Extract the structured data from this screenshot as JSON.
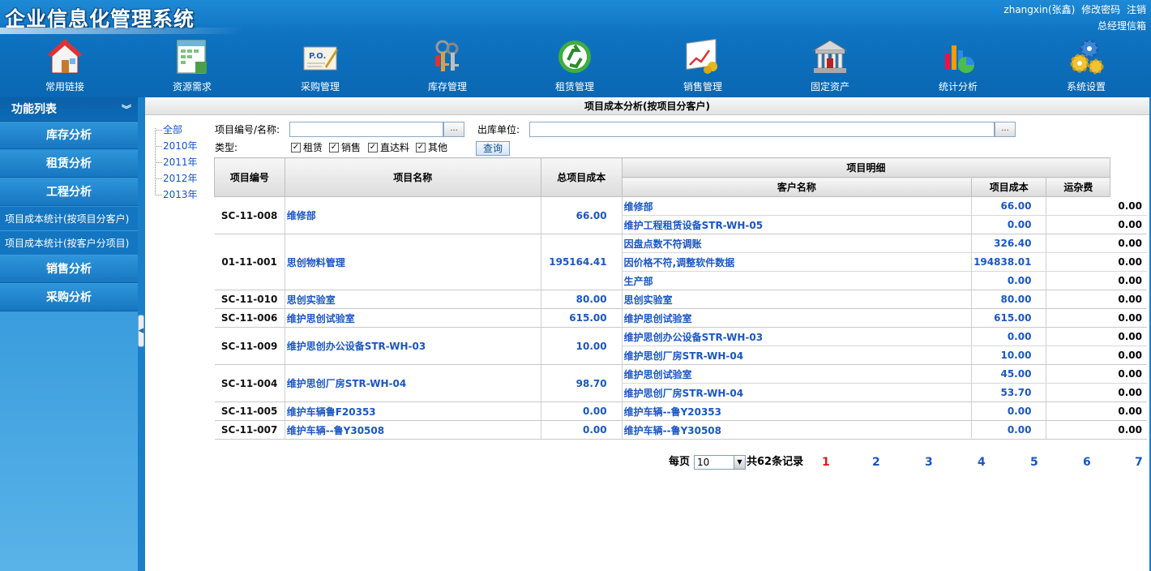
{
  "app": {
    "title": "企业信息化管理系统"
  },
  "user": {
    "name": "zhangxin(张鑫)",
    "change_password": "修改密码",
    "logout": "注销",
    "mailbox": "总经理信箱"
  },
  "nav": [
    {
      "label": "常用链接",
      "icon": "home-icon"
    },
    {
      "label": "资源需求",
      "icon": "calendar-icon"
    },
    {
      "label": "采购管理",
      "icon": "purchase-order-icon"
    },
    {
      "label": "库存管理",
      "icon": "keys-icon"
    },
    {
      "label": "租赁管理",
      "icon": "recycle-icon"
    },
    {
      "label": "销售管理",
      "icon": "sales-chart-icon"
    },
    {
      "label": "固定资产",
      "icon": "bank-icon"
    },
    {
      "label": "统计分析",
      "icon": "statistics-icon"
    },
    {
      "label": "系统设置",
      "icon": "gears-icon"
    }
  ],
  "sidebar": {
    "title": "功能列表",
    "items": [
      {
        "label": "库存分析"
      },
      {
        "label": "租赁分析"
      },
      {
        "label": "工程分析"
      }
    ],
    "subitems": [
      {
        "label": "项目成本统计(按项目分客户)"
      },
      {
        "label": "项目成本统计(按客户分项目)"
      }
    ],
    "items2": [
      {
        "label": "销售分析"
      },
      {
        "label": "采购分析"
      }
    ]
  },
  "page": {
    "title": "项目成本分析(按项目分客户)"
  },
  "tree": [
    "全部",
    "2010年",
    "2011年",
    "2012年",
    "2013年"
  ],
  "filters": {
    "project_label": "项目编号/名称:",
    "project_value": "",
    "browse": "...",
    "outbound_label": "出库单位:",
    "outbound_value": "",
    "type_label": "类型:",
    "types": [
      "租赁",
      "销售",
      "直达料",
      "其他"
    ],
    "query": "查询"
  },
  "table": {
    "headers": {
      "code": "项目编号",
      "name": "项目名称",
      "total": "总项目成本",
      "detail": "项目明细",
      "customer": "客户名称",
      "cost": "项目成本",
      "fee": "运杂费"
    },
    "rows": [
      {
        "code": "SC-11-008",
        "name": "维修部",
        "total": "66.00",
        "details": [
          {
            "customer": "维修部",
            "cost": "66.00",
            "fee": "0.00"
          },
          {
            "customer": "维护工程租赁设备STR-WH-05",
            "cost": "0.00",
            "fee": "0.00"
          }
        ]
      },
      {
        "code": "01-11-001",
        "name": "思创物料管理",
        "total": "195164.41",
        "details": [
          {
            "customer": "因盘点数不符调账",
            "cost": "326.40",
            "fee": "0.00"
          },
          {
            "customer": "因价格不符,调整软件数据",
            "cost": "194838.01",
            "fee": "0.00"
          },
          {
            "customer": "生产部",
            "cost": "0.00",
            "fee": "0.00"
          }
        ]
      },
      {
        "code": "SC-11-010",
        "name": "思创实验室",
        "total": "80.00",
        "details": [
          {
            "customer": "思创实验室",
            "cost": "80.00",
            "fee": "0.00"
          }
        ]
      },
      {
        "code": "SC-11-006",
        "name": "维护思创试验室",
        "total": "615.00",
        "details": [
          {
            "customer": "维护思创试验室",
            "cost": "615.00",
            "fee": "0.00"
          }
        ]
      },
      {
        "code": "SC-11-009",
        "name": "维护思创办公设备STR-WH-03",
        "total": "10.00",
        "details": [
          {
            "customer": "维护思创办公设备STR-WH-03",
            "cost": "0.00",
            "fee": "0.00"
          },
          {
            "customer": "维护思创厂房STR-WH-04",
            "cost": "10.00",
            "fee": "0.00"
          }
        ]
      },
      {
        "code": "SC-11-004",
        "name": "维护思创厂房STR-WH-04",
        "total": "98.70",
        "details": [
          {
            "customer": "维护思创试验室",
            "cost": "45.00",
            "fee": "0.00"
          },
          {
            "customer": "维护思创厂房STR-WH-04",
            "cost": "53.70",
            "fee": "0.00"
          }
        ]
      },
      {
        "code": "SC-11-005",
        "name": "维护车辆鲁F20353",
        "total": "0.00",
        "details": [
          {
            "customer": "维护车辆--鲁Y20353",
            "cost": "0.00",
            "fee": "0.00"
          }
        ]
      },
      {
        "code": "SC-11-007",
        "name": "维护车辆--鲁Y30508",
        "total": "0.00",
        "details": [
          {
            "customer": "维护车辆--鲁Y30508",
            "cost": "0.00",
            "fee": "0.00"
          }
        ]
      }
    ]
  },
  "pager": {
    "per_page_label": "每页",
    "per_page": "10",
    "total_prefix": "共",
    "total_count": "62",
    "total_suffix": "条记录",
    "pages": [
      "1",
      "2",
      "3",
      "4",
      "5",
      "6",
      "7"
    ],
    "current": "1"
  },
  "colors": {
    "brand": "#0e73c1",
    "link": "#1a56c4",
    "current_page": "#e01b1b"
  }
}
